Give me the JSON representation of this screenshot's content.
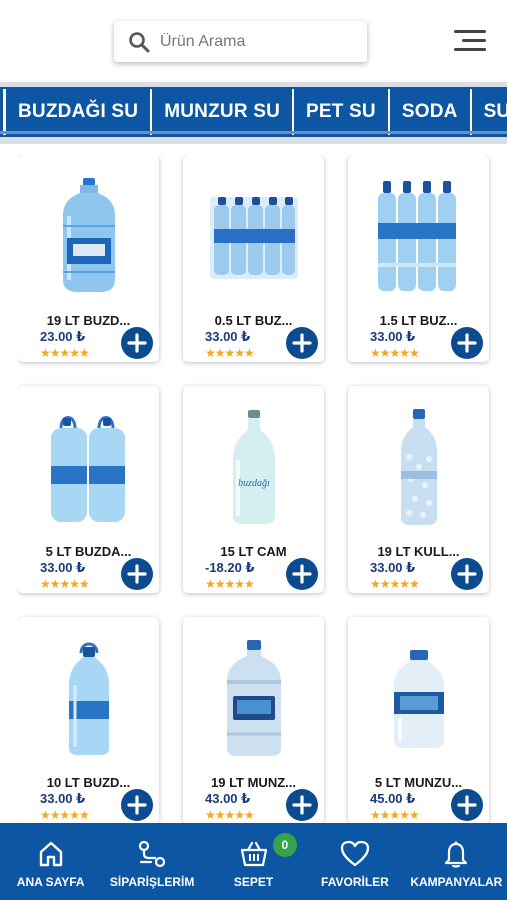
{
  "search": {
    "placeholder": "Ürün Arama",
    "icon": "search-icon"
  },
  "menu": {
    "icon": "hamburger-menu-icon"
  },
  "colors": {
    "primary": "#0d56a4",
    "price": "#1b3c78",
    "star": "#f5a623",
    "badge": "#36a34a"
  },
  "categories": [
    {
      "label": "BUZDAĞI SU"
    },
    {
      "label": "MUNZUR SU"
    },
    {
      "label": "PET SU"
    },
    {
      "label": "SODA"
    },
    {
      "label": "SU AK"
    }
  ],
  "products": [
    {
      "name": "19 LT BUZD...",
      "price": "23.00 ₺",
      "stars": "★★★★★",
      "image": "water-jug-19lt"
    },
    {
      "name": "0.5 LT BUZ...",
      "price": "33.00 ₺",
      "stars": "★★★★★",
      "image": "bottle-pack-small"
    },
    {
      "name": "1.5 LT BUZ...",
      "price": "33.00 ₺",
      "stars": "★★★★★",
      "image": "bottle-pack-large"
    },
    {
      "name": "5 LT BUZDA...",
      "price": "33.00 ₺",
      "stars": "★★★★★",
      "image": "water-5lt-pack"
    },
    {
      "name": "15 LT CAM",
      "price": "-18.20 ₺",
      "stars": "★★★★★",
      "image": "glass-jug-15lt"
    },
    {
      "name": "19 LT KULL...",
      "price": "33.00 ₺",
      "stars": "★★★★★",
      "image": "water-19lt-single"
    },
    {
      "name": "10 LT BUZD...",
      "price": "33.00 ₺",
      "stars": "★★★★★",
      "image": "water-10lt"
    },
    {
      "name": "19 LT MUNZ...",
      "price": "43.00 ₺",
      "stars": "★★★★★",
      "image": "munzur-19lt"
    },
    {
      "name": "5 LT MUNZU...",
      "price": "45.00 ₺",
      "stars": "★★★★★",
      "image": "munzur-5lt"
    }
  ],
  "cart_count": "0",
  "nav": [
    {
      "label": "ANA SAYFA",
      "icon": "home-icon"
    },
    {
      "label": "SİPARİŞLERİM",
      "icon": "orders-route-icon"
    },
    {
      "label": "SEPET",
      "icon": "basket-icon"
    },
    {
      "label": "FAVORİLER",
      "icon": "heart-icon"
    },
    {
      "label": "KAMPANYALAR",
      "icon": "bell-icon"
    }
  ]
}
